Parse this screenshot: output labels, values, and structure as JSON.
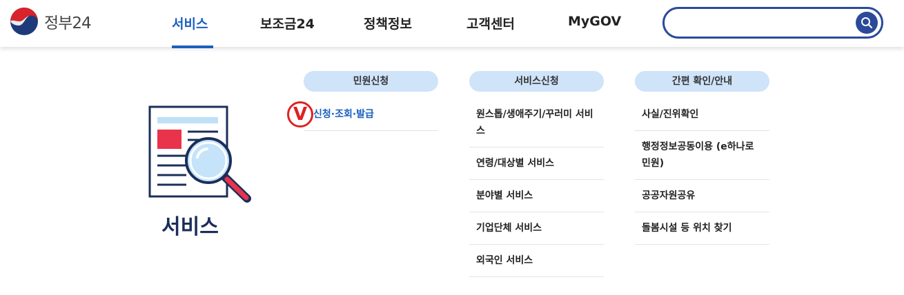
{
  "header": {
    "logo_text": "정부24",
    "nav": [
      "서비스",
      "보조금24",
      "정책정보",
      "고객센터",
      "MyGOV"
    ],
    "search_placeholder": ""
  },
  "colors": {
    "primary": "#1a5fbf",
    "navy": "#2b4a9a",
    "pill": "#cfe3f9",
    "accent": "#e02020"
  },
  "page_title": "서비스",
  "columns": [
    {
      "heading": "민원신청",
      "items": [
        "신청·조회·발급"
      ]
    },
    {
      "heading": "서비스신청",
      "items": [
        "원스톱/생애주기/꾸러미 서비스",
        "연령/대상별 서비스",
        "분야별 서비스",
        "기업단체 서비스",
        "외국인 서비스"
      ]
    },
    {
      "heading": "간편 확인/안내",
      "items": [
        "사실/진위확인",
        "행정정보공동이용 (e하나로민원)",
        "공공자원공유",
        "돌봄시설 등 위치 찾기"
      ]
    }
  ],
  "marker": {
    "label": "V"
  }
}
